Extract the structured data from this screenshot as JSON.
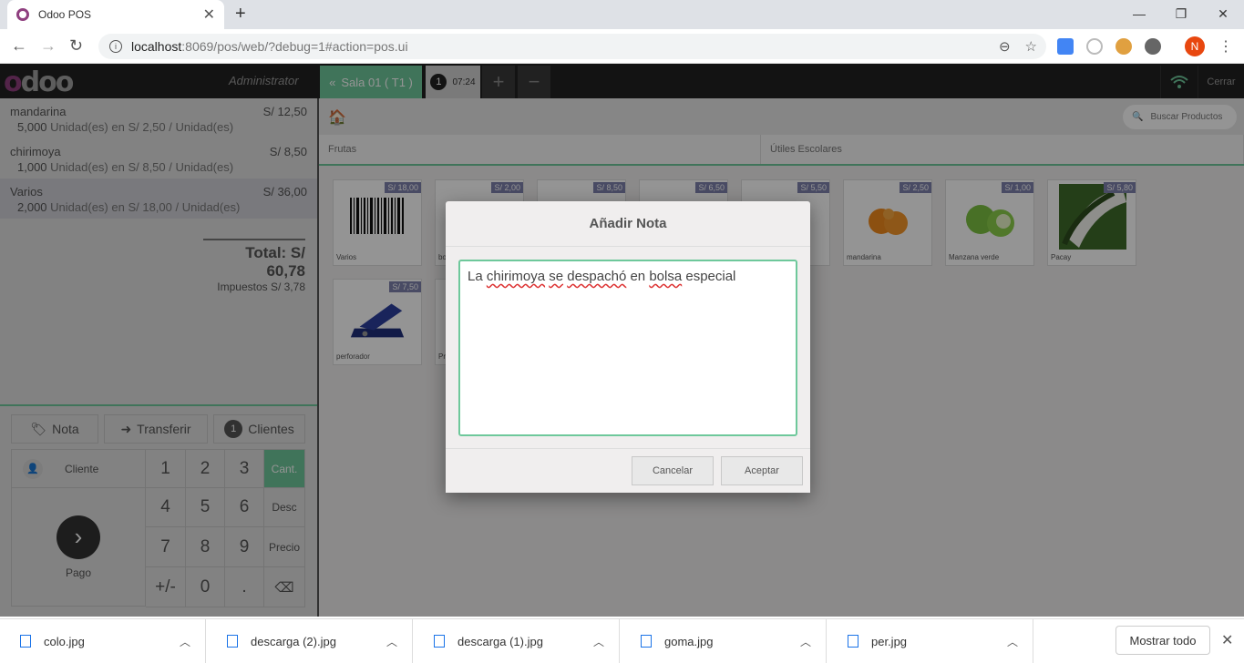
{
  "browser": {
    "tab_title": "Odoo POS",
    "url_host": "localhost",
    "url_path": ":8069/pos/web/?debug=1#action=pos.ui",
    "avatar_letter": "N"
  },
  "pos_header": {
    "logo": "odoo",
    "user": "Administrator",
    "floor_button": "Sala 01 ( T1 )",
    "order_number": "1",
    "order_time": "07:24",
    "add_order": "+",
    "remove_order": "−",
    "close": "Cerrar"
  },
  "orderlines": [
    {
      "name": "mandarina",
      "price": "S/ 12,50",
      "qty": "5,000",
      "info": "Unidad(es) en S/ 2,50 / Unidad(es)",
      "selected": false
    },
    {
      "name": "chirimoya",
      "price": "S/ 8,50",
      "qty": "1,000",
      "info": "Unidad(es) en S/ 8,50 / Unidad(es)",
      "selected": false
    },
    {
      "name": "Varios",
      "price": "S/ 36,00",
      "qty": "2,000",
      "info": "Unidad(es) en S/ 18,00 / Unidad(es)",
      "selected": true
    }
  ],
  "totals": {
    "total": "Total: S/ 60,78",
    "taxes": "Impuestos S/ 3,78"
  },
  "control_buttons": {
    "note": "Nota",
    "transfer": "Transferir",
    "guests_count": "1",
    "guests": "Clientes"
  },
  "numpad": {
    "customer": "Cliente",
    "payment": "Pago",
    "keys": [
      "1",
      "2",
      "3",
      "4",
      "5",
      "6",
      "7",
      "8",
      "9",
      "+/-",
      "0",
      "."
    ],
    "mode_qty": "Cant.",
    "mode_disc": "Desc",
    "mode_price": "Precio"
  },
  "products_screen": {
    "search_placeholder": "Buscar Productos",
    "categories": [
      "Frutas",
      "Útiles Escolares"
    ],
    "products": [
      {
        "name": "Varios",
        "price": "S/ 18,00"
      },
      {
        "name": "bo",
        "price": "S/ 2,00"
      },
      {
        "name": "",
        "price": "S/ 8,50"
      },
      {
        "name": "",
        "price": "S/ 6,50"
      },
      {
        "name": "",
        "price": "S/ 5,50"
      },
      {
        "name": "mandarina",
        "price": "S/ 2,50"
      },
      {
        "name": "Manzana verde",
        "price": "S/ 1,00"
      },
      {
        "name": "Pacay",
        "price": "S/ 5,80"
      },
      {
        "name": "perforador",
        "price": "S/ 7,50"
      },
      {
        "name": "Pr",
        "price": ""
      }
    ]
  },
  "modal": {
    "title": "Añadir Nota",
    "note_parts": [
      "La ",
      "chirimoya",
      " ",
      "se",
      " ",
      "despachó",
      " en ",
      "bolsa",
      " especial"
    ],
    "cancel": "Cancelar",
    "accept": "Aceptar"
  },
  "downloads": {
    "files": [
      "colo.jpg",
      "descarga (2).jpg",
      "descarga (1).jpg",
      "goma.jpg",
      "per.jpg"
    ],
    "show_all": "Mostrar todo"
  },
  "colors": {
    "accent": "#6ec89b",
    "header_bg": "#222222",
    "price_tag": "#7f82ac"
  }
}
